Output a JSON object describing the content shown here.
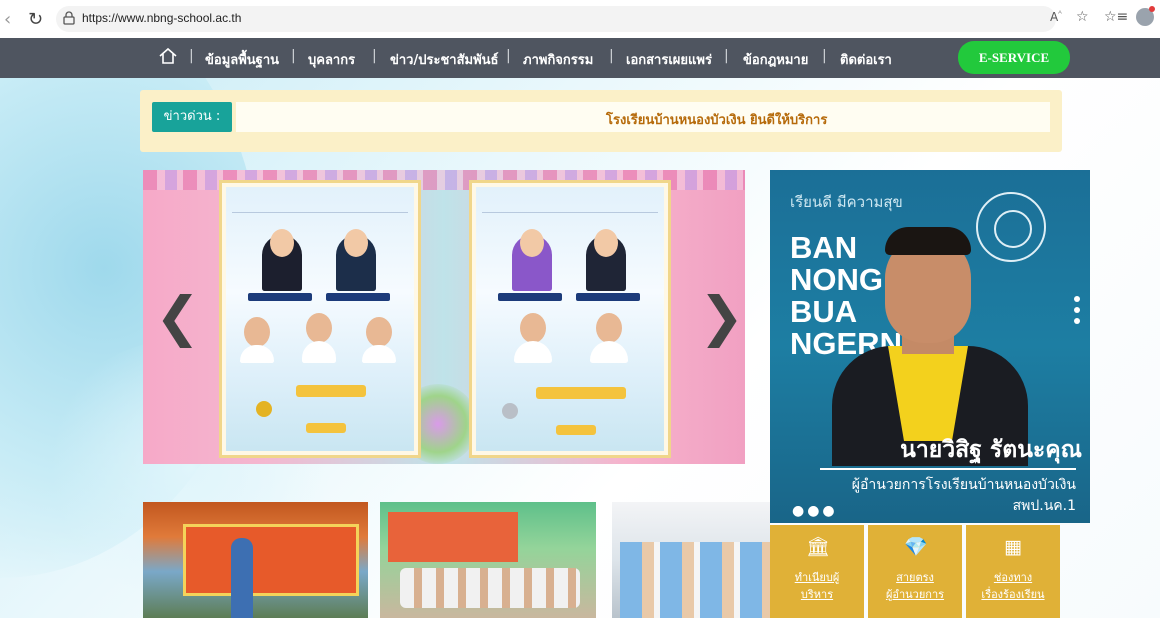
{
  "browser": {
    "url": "https://www.nbng-school.ac.th",
    "reader_label": "A̩"
  },
  "nav": {
    "items": [
      "ข้อมูลพื้นฐาน",
      "บุคลากร",
      "ข่าว/ประชาสัมพันธ์",
      "ภาพกิจกรรม",
      "เอกสารเผยแพร่",
      "ข้อกฎหมาย",
      "ติดต่อเรา"
    ],
    "eservice": "E-SERVICE"
  },
  "ticker": {
    "label": "ข่าวด่วน :",
    "text": "โรงเรียนบ้านหนองบัวเงิน ยินดีให้บริการ"
  },
  "principal": {
    "slogan": "เรียนดี มีความสุข",
    "school_en": [
      "BAN",
      "NONG",
      "BUA",
      "NGERN"
    ],
    "name": "นายวิสิฐ  รัตนะคุณ",
    "role": "ผู้อำนวยการโรงเรียนบ้านหนองบัวเงิน",
    "office": "สพป.นค.1"
  },
  "quick_links": [
    {
      "line1": "ทำเนียบผู้",
      "line2": "บริหาร"
    },
    {
      "line1": "สายตรง",
      "line2": "ผู้อำนวยการ"
    },
    {
      "line1": "ช่องทาง",
      "line2": "เรื่องร้องเรียน"
    }
  ],
  "colors": {
    "nav_bg": "#4f5560",
    "eservice": "#22c93c",
    "ticker_label": "#18a39a",
    "ticker_text": "#b66a0a",
    "quick_bg": "#dda926",
    "principal_bg": "#1d7ea3"
  }
}
